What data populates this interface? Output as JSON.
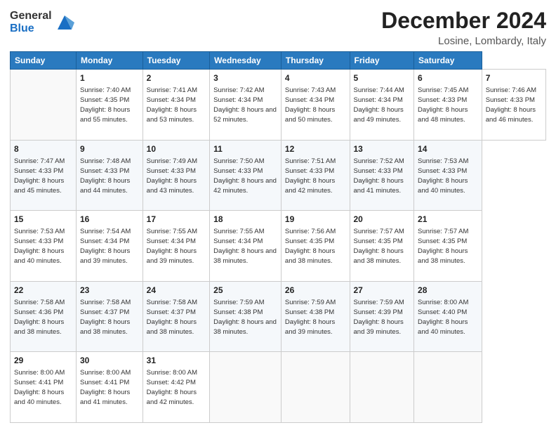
{
  "header": {
    "logo_general": "General",
    "logo_blue": "Blue",
    "title": "December 2024",
    "subtitle": "Losine, Lombardy, Italy"
  },
  "calendar": {
    "weekdays": [
      "Sunday",
      "Monday",
      "Tuesday",
      "Wednesday",
      "Thursday",
      "Friday",
      "Saturday"
    ],
    "weeks": [
      [
        null,
        {
          "day": 1,
          "sunrise": "Sunrise: 7:40 AM",
          "sunset": "Sunset: 4:35 PM",
          "daylight": "Daylight: 8 hours and 55 minutes."
        },
        {
          "day": 2,
          "sunrise": "Sunrise: 7:41 AM",
          "sunset": "Sunset: 4:34 PM",
          "daylight": "Daylight: 8 hours and 53 minutes."
        },
        {
          "day": 3,
          "sunrise": "Sunrise: 7:42 AM",
          "sunset": "Sunset: 4:34 PM",
          "daylight": "Daylight: 8 hours and 52 minutes."
        },
        {
          "day": 4,
          "sunrise": "Sunrise: 7:43 AM",
          "sunset": "Sunset: 4:34 PM",
          "daylight": "Daylight: 8 hours and 50 minutes."
        },
        {
          "day": 5,
          "sunrise": "Sunrise: 7:44 AM",
          "sunset": "Sunset: 4:34 PM",
          "daylight": "Daylight: 8 hours and 49 minutes."
        },
        {
          "day": 6,
          "sunrise": "Sunrise: 7:45 AM",
          "sunset": "Sunset: 4:33 PM",
          "daylight": "Daylight: 8 hours and 48 minutes."
        },
        {
          "day": 7,
          "sunrise": "Sunrise: 7:46 AM",
          "sunset": "Sunset: 4:33 PM",
          "daylight": "Daylight: 8 hours and 46 minutes."
        }
      ],
      [
        {
          "day": 8,
          "sunrise": "Sunrise: 7:47 AM",
          "sunset": "Sunset: 4:33 PM",
          "daylight": "Daylight: 8 hours and 45 minutes."
        },
        {
          "day": 9,
          "sunrise": "Sunrise: 7:48 AM",
          "sunset": "Sunset: 4:33 PM",
          "daylight": "Daylight: 8 hours and 44 minutes."
        },
        {
          "day": 10,
          "sunrise": "Sunrise: 7:49 AM",
          "sunset": "Sunset: 4:33 PM",
          "daylight": "Daylight: 8 hours and 43 minutes."
        },
        {
          "day": 11,
          "sunrise": "Sunrise: 7:50 AM",
          "sunset": "Sunset: 4:33 PM",
          "daylight": "Daylight: 8 hours and 42 minutes."
        },
        {
          "day": 12,
          "sunrise": "Sunrise: 7:51 AM",
          "sunset": "Sunset: 4:33 PM",
          "daylight": "Daylight: 8 hours and 42 minutes."
        },
        {
          "day": 13,
          "sunrise": "Sunrise: 7:52 AM",
          "sunset": "Sunset: 4:33 PM",
          "daylight": "Daylight: 8 hours and 41 minutes."
        },
        {
          "day": 14,
          "sunrise": "Sunrise: 7:53 AM",
          "sunset": "Sunset: 4:33 PM",
          "daylight": "Daylight: 8 hours and 40 minutes."
        }
      ],
      [
        {
          "day": 15,
          "sunrise": "Sunrise: 7:53 AM",
          "sunset": "Sunset: 4:33 PM",
          "daylight": "Daylight: 8 hours and 40 minutes."
        },
        {
          "day": 16,
          "sunrise": "Sunrise: 7:54 AM",
          "sunset": "Sunset: 4:34 PM",
          "daylight": "Daylight: 8 hours and 39 minutes."
        },
        {
          "day": 17,
          "sunrise": "Sunrise: 7:55 AM",
          "sunset": "Sunset: 4:34 PM",
          "daylight": "Daylight: 8 hours and 39 minutes."
        },
        {
          "day": 18,
          "sunrise": "Sunrise: 7:55 AM",
          "sunset": "Sunset: 4:34 PM",
          "daylight": "Daylight: 8 hours and 38 minutes."
        },
        {
          "day": 19,
          "sunrise": "Sunrise: 7:56 AM",
          "sunset": "Sunset: 4:35 PM",
          "daylight": "Daylight: 8 hours and 38 minutes."
        },
        {
          "day": 20,
          "sunrise": "Sunrise: 7:57 AM",
          "sunset": "Sunset: 4:35 PM",
          "daylight": "Daylight: 8 hours and 38 minutes."
        },
        {
          "day": 21,
          "sunrise": "Sunrise: 7:57 AM",
          "sunset": "Sunset: 4:35 PM",
          "daylight": "Daylight: 8 hours and 38 minutes."
        }
      ],
      [
        {
          "day": 22,
          "sunrise": "Sunrise: 7:58 AM",
          "sunset": "Sunset: 4:36 PM",
          "daylight": "Daylight: 8 hours and 38 minutes."
        },
        {
          "day": 23,
          "sunrise": "Sunrise: 7:58 AM",
          "sunset": "Sunset: 4:37 PM",
          "daylight": "Daylight: 8 hours and 38 minutes."
        },
        {
          "day": 24,
          "sunrise": "Sunrise: 7:58 AM",
          "sunset": "Sunset: 4:37 PM",
          "daylight": "Daylight: 8 hours and 38 minutes."
        },
        {
          "day": 25,
          "sunrise": "Sunrise: 7:59 AM",
          "sunset": "Sunset: 4:38 PM",
          "daylight": "Daylight: 8 hours and 38 minutes."
        },
        {
          "day": 26,
          "sunrise": "Sunrise: 7:59 AM",
          "sunset": "Sunset: 4:38 PM",
          "daylight": "Daylight: 8 hours and 39 minutes."
        },
        {
          "day": 27,
          "sunrise": "Sunrise: 7:59 AM",
          "sunset": "Sunset: 4:39 PM",
          "daylight": "Daylight: 8 hours and 39 minutes."
        },
        {
          "day": 28,
          "sunrise": "Sunrise: 8:00 AM",
          "sunset": "Sunset: 4:40 PM",
          "daylight": "Daylight: 8 hours and 40 minutes."
        }
      ],
      [
        {
          "day": 29,
          "sunrise": "Sunrise: 8:00 AM",
          "sunset": "Sunset: 4:41 PM",
          "daylight": "Daylight: 8 hours and 40 minutes."
        },
        {
          "day": 30,
          "sunrise": "Sunrise: 8:00 AM",
          "sunset": "Sunset: 4:41 PM",
          "daylight": "Daylight: 8 hours and 41 minutes."
        },
        {
          "day": 31,
          "sunrise": "Sunrise: 8:00 AM",
          "sunset": "Sunset: 4:42 PM",
          "daylight": "Daylight: 8 hours and 42 minutes."
        },
        null,
        null,
        null,
        null
      ]
    ]
  }
}
